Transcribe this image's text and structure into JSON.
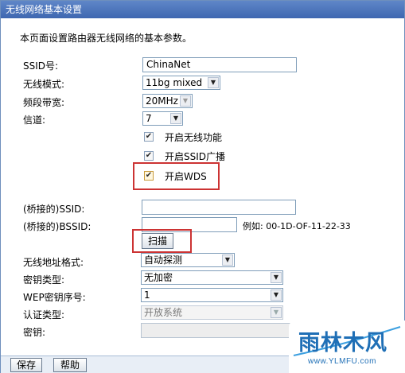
{
  "window": {
    "title": "无线网络基本设置"
  },
  "description": "本页面设置路由器无线网络的基本参数。",
  "fields": {
    "ssid": {
      "label": "SSID号:",
      "value": "ChinaNet"
    },
    "mode": {
      "label": "无线模式:",
      "value": "11bg mixed"
    },
    "bandwidth": {
      "label": "频段带宽:",
      "value": "20MHz"
    },
    "channel": {
      "label": "信道:",
      "value": "7"
    }
  },
  "checkboxes": {
    "enable_wireless": {
      "label": "开启无线功能",
      "checked": true
    },
    "enable_ssid_broadcast": {
      "label": "开启SSID广播",
      "checked": true
    },
    "enable_wds": {
      "label": "开启WDS",
      "checked": true
    }
  },
  "wds": {
    "bridged_ssid": {
      "label": "(桥接的)SSID:",
      "value": ""
    },
    "bridged_bssid": {
      "label": "(桥接的)BSSID:",
      "value": "",
      "example": "例如: 00-1D-OF-11-22-33"
    },
    "scan_label": "扫描",
    "address_format": {
      "label": "无线地址格式:",
      "value": "自动探测"
    },
    "key_type": {
      "label": "密钥类型:",
      "value": "无加密"
    },
    "wep_index": {
      "label": "WEP密钥序号:",
      "value": "1"
    },
    "auth_type": {
      "label": "认证类型:",
      "value": "开放系统"
    },
    "key": {
      "label": "密钥:",
      "value": ""
    }
  },
  "buttons": {
    "save": "保存",
    "help": "帮助"
  },
  "watermark": {
    "text": "雨林木风",
    "url": "www.YLMFU.com"
  },
  "icons": {
    "dropdown": "dropdown-arrow-icon",
    "check": "check-icon"
  },
  "colors": {
    "title_bar": "#4a73b9",
    "highlight_box": "#cc3333",
    "watermark": "#1f6fb6"
  }
}
